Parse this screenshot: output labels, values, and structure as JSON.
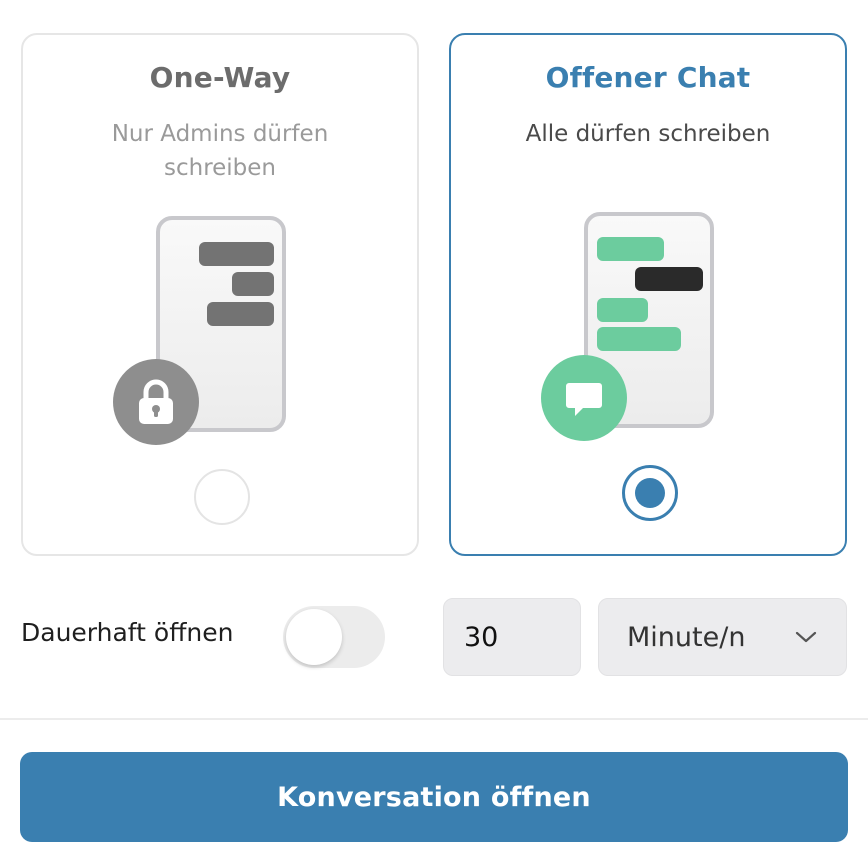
{
  "options": [
    {
      "id": "one-way",
      "title": "One-Way",
      "description": "Nur Admins dürfen schreiben",
      "selected": false,
      "badge_icon": "lock-icon"
    },
    {
      "id": "open-chat",
      "title": "Offener Chat",
      "description": "Alle dürfen schreiben",
      "selected": true,
      "badge_icon": "chat-bubble-icon"
    }
  ],
  "permanent": {
    "label": "Dauerhaft öffnen",
    "enabled": false
  },
  "duration": {
    "value": "30",
    "unit_selected": "Minute/n",
    "unit_icon": "chevron-down-icon"
  },
  "submit_label": "Konversation öffnen",
  "colors": {
    "accent": "#3a7fb0",
    "green": "#6ccc9e",
    "grey_icon": "#8e8e8e",
    "card_border": "#e6e6e6"
  }
}
